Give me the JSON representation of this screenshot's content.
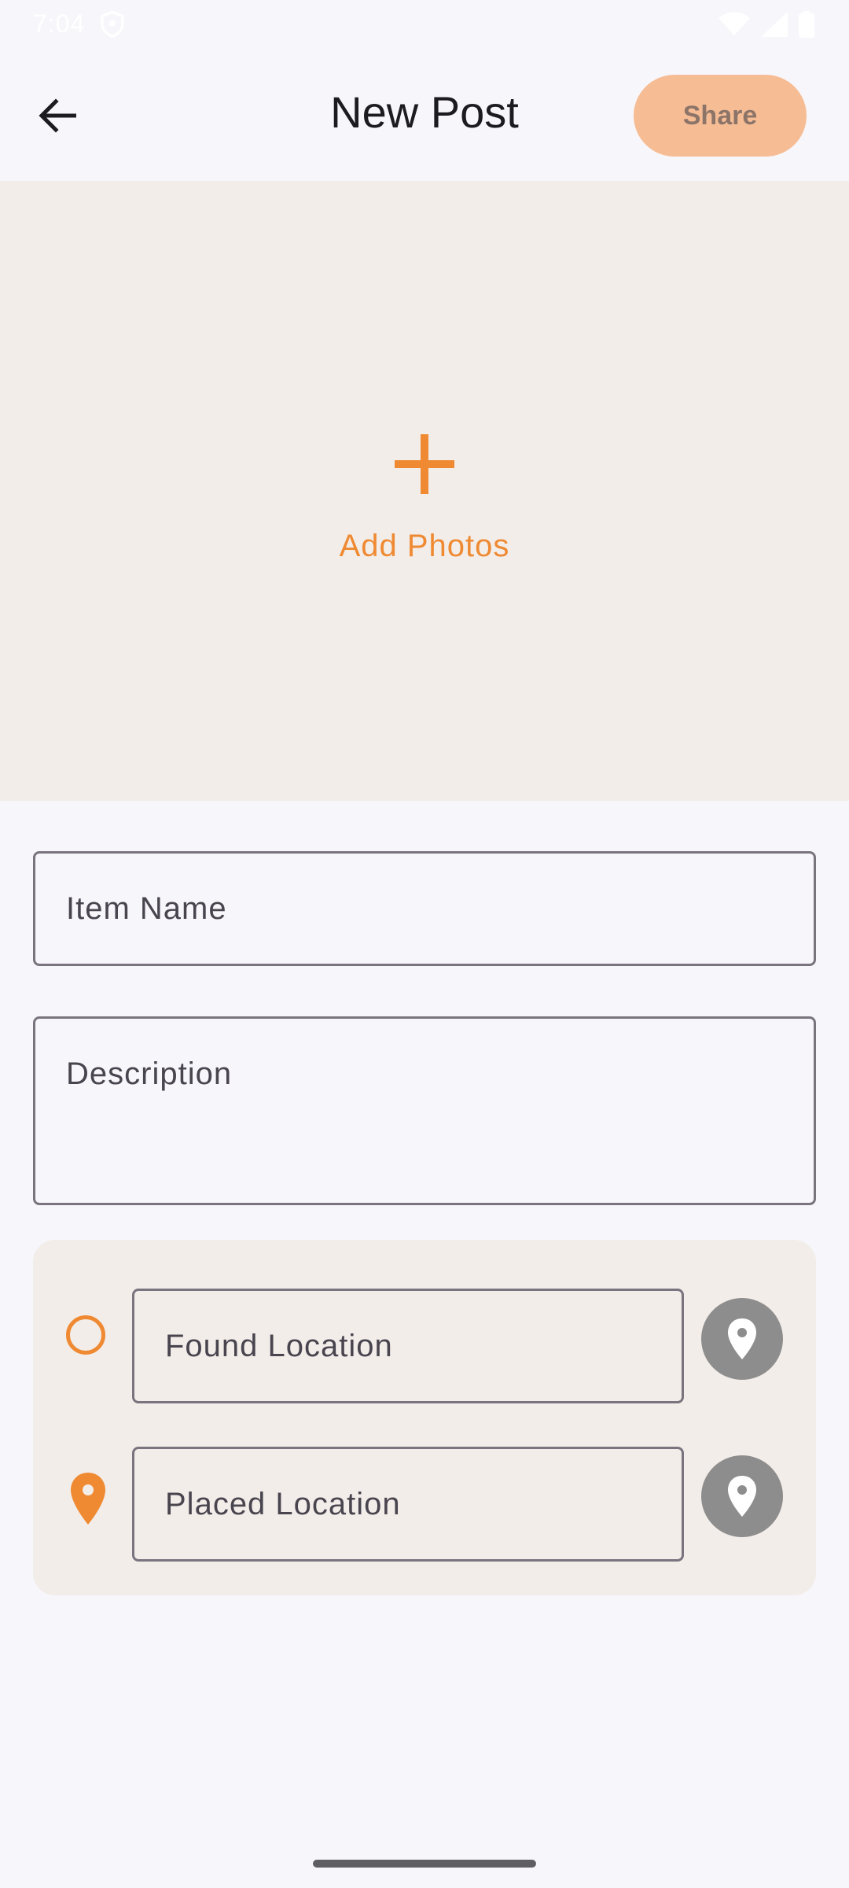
{
  "status_bar": {
    "time": "7:04",
    "shield_icon": "shield-icon",
    "wifi_icon": "wifi-icon",
    "signal_icon": "signal-icon",
    "battery_icon": "battery-icon"
  },
  "header": {
    "back_icon": "arrow-left-icon",
    "title": "New Post",
    "share_label": "Share"
  },
  "photos": {
    "add_icon": "plus-icon",
    "add_label": "Add Photos"
  },
  "form": {
    "item_name_label": "Item Name",
    "description_label": "Description",
    "found_location_label": "Found Location",
    "placed_location_label": "Placed Location",
    "found_selector_icon": "radio-circle-icon",
    "placed_selector_icon": "map-pin-icon",
    "pick_location_icon": "map-pin-icon"
  },
  "colors": {
    "accent": "#ef8a33",
    "share_button_bg": "#f6bd95",
    "panel_bg": "#f2ede9",
    "page_bg": "#f7f6fb",
    "pin_button_bg": "#8d8d8d"
  }
}
